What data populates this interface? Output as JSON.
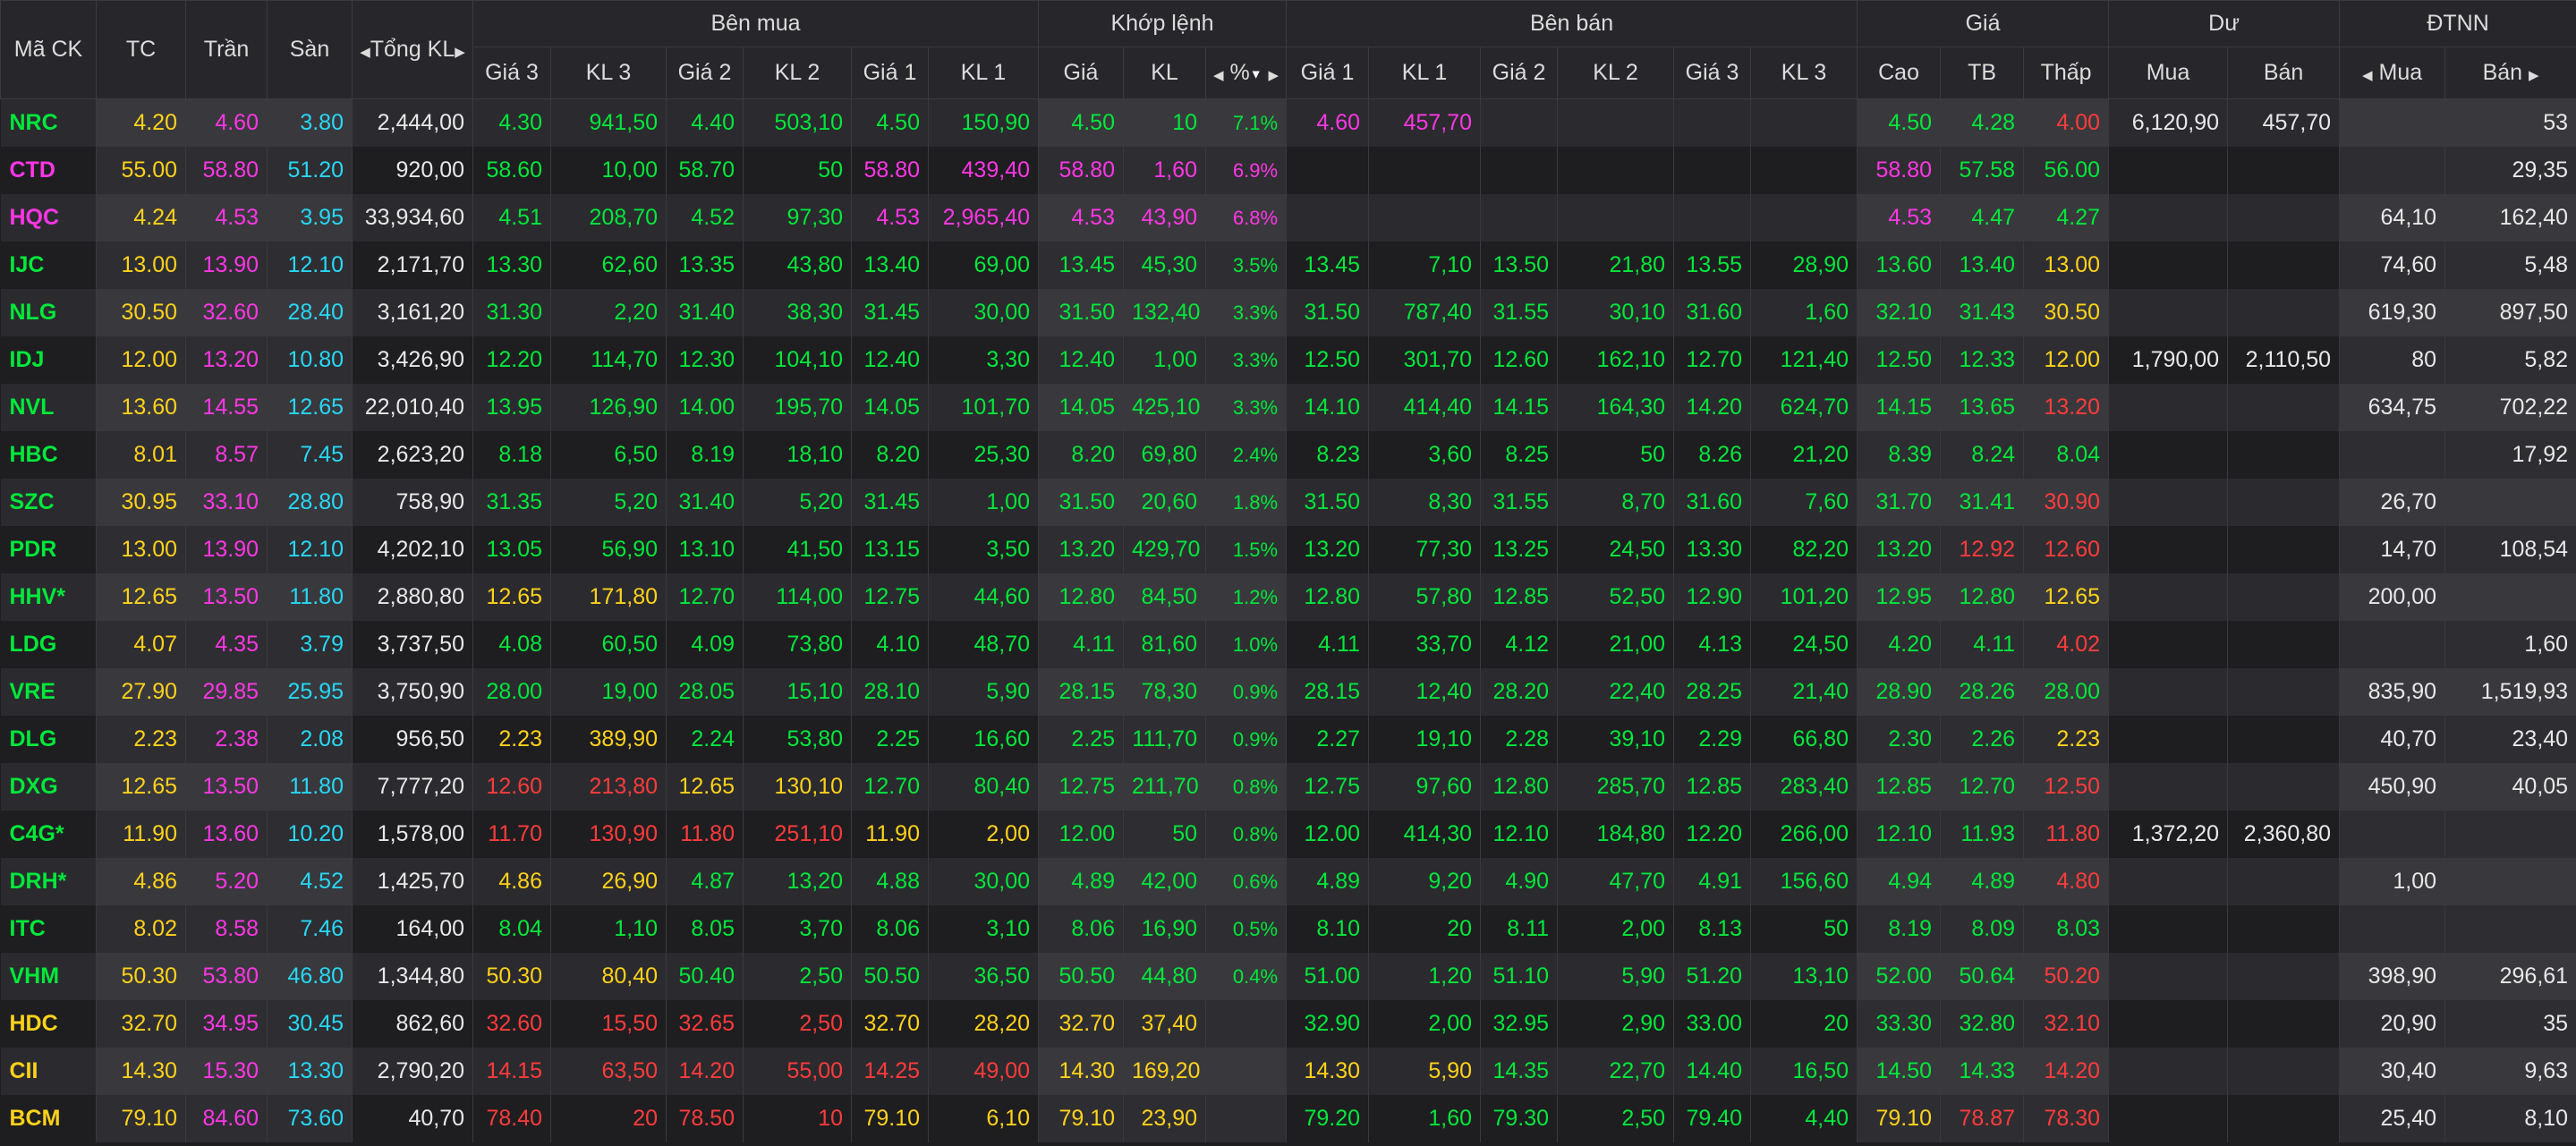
{
  "header": {
    "symbol": "Mã CK",
    "ref": "TC",
    "ceiling": "Trần",
    "floor": "Sàn",
    "total_vol": "Tổng KL",
    "buy_group": "Bên mua",
    "match_group": "Khớp lệnh",
    "sell_group": "Bên bán",
    "price_group": "Giá",
    "remain_group": "Dư",
    "foreign_group": "ĐTNN",
    "sub": {
      "price3": "Giá 3",
      "vol3": "KL 3",
      "price2": "Giá 2",
      "vol2": "KL 2",
      "price1": "Giá 1",
      "vol1": "KL 1",
      "match_price": "Giá",
      "match_vol": "KL",
      "match_pct": "%",
      "high": "Cao",
      "avg": "TB",
      "low": "Thấp",
      "remain_buy": "Mua",
      "remain_sell": "Bán",
      "foreign_buy": "Mua",
      "foreign_sell": "Bán"
    }
  },
  "colors": {
    "up": "#00e83a",
    "ref": "#ffd21a",
    "down": "#ff3b3b",
    "ceiling": "#ff36e5",
    "floor": "#27d8f5",
    "neutral": "#e8e8e8",
    "header_bg": "#27272b",
    "row_odd": "#2b2b2f",
    "row_even": "#1e1e21"
  },
  "icons": {
    "arrow_left": "caret-left-icon",
    "arrow_right": "caret-right-icon",
    "sort_desc": "sort-desc-icon"
  },
  "rows": [
    {
      "sym": "NRC",
      "tc": "4.20",
      "tran": "4.60",
      "san": "3.80",
      "tkl": "2,444,00",
      "g3": "4.30",
      "k3": "941,50",
      "g2": "4.40",
      "k2": "503,10",
      "g1": "4.50",
      "k1": "150,90",
      "mp": "4.50",
      "mv": "10",
      "pct": "7.1%",
      "s1": "4.60",
      "sk1": "457,70",
      "s2": "",
      "sk2": "",
      "s3": "",
      "sk3": "",
      "hi": "4.50",
      "avg": "4.28",
      "lo": "4.00",
      "rb": "6,120,90",
      "rs": "457,70",
      "fb": "",
      "fs": "53",
      "c": {
        "sym": "g",
        "b3": "g",
        "b2": "g",
        "b1": "g",
        "m": "g",
        "s1": "m",
        "s2": "g",
        "s3": "g",
        "hi": "g",
        "avg": "g",
        "lo": "r"
      }
    },
    {
      "sym": "CTD",
      "tc": "55.00",
      "tran": "58.80",
      "san": "51.20",
      "tkl": "920,00",
      "g3": "58.60",
      "k3": "10,00",
      "g2": "58.70",
      "k2": "50",
      "g1": "58.80",
      "k1": "439,40",
      "mp": "58.80",
      "mv": "1,60",
      "pct": "6.9%",
      "s1": "",
      "sk1": "",
      "s2": "",
      "sk2": "",
      "s3": "",
      "sk3": "",
      "hi": "58.80",
      "avg": "57.58",
      "lo": "56.00",
      "rb": "",
      "rs": "",
      "fb": "",
      "fs": "29,35",
      "c": {
        "sym": "m",
        "b3": "g",
        "b2": "g",
        "b1": "m",
        "m": "m",
        "s1": "g",
        "s2": "g",
        "s3": "g",
        "hi": "m",
        "avg": "g",
        "lo": "g"
      }
    },
    {
      "sym": "HQC",
      "tc": "4.24",
      "tran": "4.53",
      "san": "3.95",
      "tkl": "33,934,60",
      "g3": "4.51",
      "k3": "208,70",
      "g2": "4.52",
      "k2": "97,30",
      "g1": "4.53",
      "k1": "2,965,40",
      "mp": "4.53",
      "mv": "43,90",
      "pct": "6.8%",
      "s1": "",
      "sk1": "",
      "s2": "",
      "sk2": "",
      "s3": "",
      "sk3": "",
      "hi": "4.53",
      "avg": "4.47",
      "lo": "4.27",
      "rb": "",
      "rs": "",
      "fb": "64,10",
      "fs": "162,40",
      "c": {
        "sym": "m",
        "b3": "g",
        "b2": "g",
        "b1": "m",
        "m": "m",
        "s1": "g",
        "s2": "g",
        "s3": "g",
        "hi": "m",
        "avg": "g",
        "lo": "g"
      }
    },
    {
      "sym": "IJC",
      "tc": "13.00",
      "tran": "13.90",
      "san": "12.10",
      "tkl": "2,171,70",
      "g3": "13.30",
      "k3": "62,60",
      "g2": "13.35",
      "k2": "43,80",
      "g1": "13.40",
      "k1": "69,00",
      "mp": "13.45",
      "mv": "45,30",
      "pct": "3.5%",
      "s1": "13.45",
      "sk1": "7,10",
      "s2": "13.50",
      "sk2": "21,80",
      "s3": "13.55",
      "sk3": "28,90",
      "hi": "13.60",
      "avg": "13.40",
      "lo": "13.00",
      "rb": "",
      "rs": "",
      "fb": "74,60",
      "fs": "5,48",
      "c": {
        "sym": "g",
        "b3": "g",
        "b2": "g",
        "b1": "g",
        "m": "g",
        "s1": "g",
        "s2": "g",
        "s3": "g",
        "hi": "g",
        "avg": "g",
        "lo": "y"
      }
    },
    {
      "sym": "NLG",
      "tc": "30.50",
      "tran": "32.60",
      "san": "28.40",
      "tkl": "3,161,20",
      "g3": "31.30",
      "k3": "2,20",
      "g2": "31.40",
      "k2": "38,30",
      "g1": "31.45",
      "k1": "30,00",
      "mp": "31.50",
      "mv": "132,40",
      "pct": "3.3%",
      "s1": "31.50",
      "sk1": "787,40",
      "s2": "31.55",
      "sk2": "30,10",
      "s3": "31.60",
      "sk3": "1,60",
      "hi": "32.10",
      "avg": "31.43",
      "lo": "30.50",
      "rb": "",
      "rs": "",
      "fb": "619,30",
      "fs": "897,50",
      "c": {
        "sym": "g",
        "b3": "g",
        "b2": "g",
        "b1": "g",
        "m": "g",
        "s1": "g",
        "s2": "g",
        "s3": "g",
        "hi": "g",
        "avg": "g",
        "lo": "y"
      }
    },
    {
      "sym": "IDJ",
      "tc": "12.00",
      "tran": "13.20",
      "san": "10.80",
      "tkl": "3,426,90",
      "g3": "12.20",
      "k3": "114,70",
      "g2": "12.30",
      "k2": "104,10",
      "g1": "12.40",
      "k1": "3,30",
      "mp": "12.40",
      "mv": "1,00",
      "pct": "3.3%",
      "s1": "12.50",
      "sk1": "301,70",
      "s2": "12.60",
      "sk2": "162,10",
      "s3": "12.70",
      "sk3": "121,40",
      "hi": "12.50",
      "avg": "12.33",
      "lo": "12.00",
      "rb": "1,790,00",
      "rs": "2,110,50",
      "fb": "80",
      "fs": "5,82",
      "c": {
        "sym": "g",
        "b3": "g",
        "b2": "g",
        "b1": "g",
        "m": "g",
        "s1": "g",
        "s2": "g",
        "s3": "g",
        "hi": "g",
        "avg": "g",
        "lo": "y"
      }
    },
    {
      "sym": "NVL",
      "tc": "13.60",
      "tran": "14.55",
      "san": "12.65",
      "tkl": "22,010,40",
      "g3": "13.95",
      "k3": "126,90",
      "g2": "14.00",
      "k2": "195,70",
      "g1": "14.05",
      "k1": "101,70",
      "mp": "14.05",
      "mv": "425,10",
      "pct": "3.3%",
      "s1": "14.10",
      "sk1": "414,40",
      "s2": "14.15",
      "sk2": "164,30",
      "s3": "14.20",
      "sk3": "624,70",
      "hi": "14.15",
      "avg": "13.65",
      "lo": "13.20",
      "rb": "",
      "rs": "",
      "fb": "634,75",
      "fs": "702,22",
      "c": {
        "sym": "g",
        "b3": "g",
        "b2": "g",
        "b1": "g",
        "m": "g",
        "s1": "g",
        "s2": "g",
        "s3": "g",
        "hi": "g",
        "avg": "g",
        "lo": "r"
      }
    },
    {
      "sym": "HBC",
      "tc": "8.01",
      "tran": "8.57",
      "san": "7.45",
      "tkl": "2,623,20",
      "g3": "8.18",
      "k3": "6,50",
      "g2": "8.19",
      "k2": "18,10",
      "g1": "8.20",
      "k1": "25,30",
      "mp": "8.20",
      "mv": "69,80",
      "pct": "2.4%",
      "s1": "8.23",
      "sk1": "3,60",
      "s2": "8.25",
      "sk2": "50",
      "s3": "8.26",
      "sk3": "21,20",
      "hi": "8.39",
      "avg": "8.24",
      "lo": "8.04",
      "rb": "",
      "rs": "",
      "fb": "",
      "fs": "17,92",
      "c": {
        "sym": "g",
        "b3": "g",
        "b2": "g",
        "b1": "g",
        "m": "g",
        "s1": "g",
        "s2": "g",
        "s3": "g",
        "hi": "g",
        "avg": "g",
        "lo": "g"
      }
    },
    {
      "sym": "SZC",
      "tc": "30.95",
      "tran": "33.10",
      "san": "28.80",
      "tkl": "758,90",
      "g3": "31.35",
      "k3": "5,20",
      "g2": "31.40",
      "k2": "5,20",
      "g1": "31.45",
      "k1": "1,00",
      "mp": "31.50",
      "mv": "20,60",
      "pct": "1.8%",
      "s1": "31.50",
      "sk1": "8,30",
      "s2": "31.55",
      "sk2": "8,70",
      "s3": "31.60",
      "sk3": "7,60",
      "hi": "31.70",
      "avg": "31.41",
      "lo": "30.90",
      "rb": "",
      "rs": "",
      "fb": "26,70",
      "fs": "",
      "c": {
        "sym": "g",
        "b3": "g",
        "b2": "g",
        "b1": "g",
        "m": "g",
        "s1": "g",
        "s2": "g",
        "s3": "g",
        "hi": "g",
        "avg": "g",
        "lo": "r"
      }
    },
    {
      "sym": "PDR",
      "tc": "13.00",
      "tran": "13.90",
      "san": "12.10",
      "tkl": "4,202,10",
      "g3": "13.05",
      "k3": "56,90",
      "g2": "13.10",
      "k2": "41,50",
      "g1": "13.15",
      "k1": "3,50",
      "mp": "13.20",
      "mv": "429,70",
      "pct": "1.5%",
      "s1": "13.20",
      "sk1": "77,30",
      "s2": "13.25",
      "sk2": "24,50",
      "s3": "13.30",
      "sk3": "82,20",
      "hi": "13.20",
      "avg": "12.92",
      "lo": "12.60",
      "rb": "",
      "rs": "",
      "fb": "14,70",
      "fs": "108,54",
      "c": {
        "sym": "g",
        "b3": "g",
        "b2": "g",
        "b1": "g",
        "m": "g",
        "s1": "g",
        "s2": "g",
        "s3": "g",
        "hi": "g",
        "avg": "r",
        "lo": "r"
      }
    },
    {
      "sym": "HHV*",
      "tc": "12.65",
      "tran": "13.50",
      "san": "11.80",
      "tkl": "2,880,80",
      "g3": "12.65",
      "k3": "171,80",
      "g2": "12.70",
      "k2": "114,00",
      "g1": "12.75",
      "k1": "44,60",
      "mp": "12.80",
      "mv": "84,50",
      "pct": "1.2%",
      "s1": "12.80",
      "sk1": "57,80",
      "s2": "12.85",
      "sk2": "52,50",
      "s3": "12.90",
      "sk3": "101,20",
      "hi": "12.95",
      "avg": "12.80",
      "lo": "12.65",
      "rb": "",
      "rs": "",
      "fb": "200,00",
      "fs": "",
      "c": {
        "sym": "g",
        "b3": "y",
        "b2": "g",
        "b1": "g",
        "m": "g",
        "s1": "g",
        "s2": "g",
        "s3": "g",
        "hi": "g",
        "avg": "g",
        "lo": "y"
      }
    },
    {
      "sym": "LDG",
      "tc": "4.07",
      "tran": "4.35",
      "san": "3.79",
      "tkl": "3,737,50",
      "g3": "4.08",
      "k3": "60,50",
      "g2": "4.09",
      "k2": "73,80",
      "g1": "4.10",
      "k1": "48,70",
      "mp": "4.11",
      "mv": "81,60",
      "pct": "1.0%",
      "s1": "4.11",
      "sk1": "33,70",
      "s2": "4.12",
      "sk2": "21,00",
      "s3": "4.13",
      "sk3": "24,50",
      "hi": "4.20",
      "avg": "4.11",
      "lo": "4.02",
      "rb": "",
      "rs": "",
      "fb": "",
      "fs": "1,60",
      "c": {
        "sym": "g",
        "b3": "g",
        "b2": "g",
        "b1": "g",
        "m": "g",
        "s1": "g",
        "s2": "g",
        "s3": "g",
        "hi": "g",
        "avg": "g",
        "lo": "r"
      }
    },
    {
      "sym": "VRE",
      "tc": "27.90",
      "tran": "29.85",
      "san": "25.95",
      "tkl": "3,750,90",
      "g3": "28.00",
      "k3": "19,00",
      "g2": "28.05",
      "k2": "15,10",
      "g1": "28.10",
      "k1": "5,90",
      "mp": "28.15",
      "mv": "78,30",
      "pct": "0.9%",
      "s1": "28.15",
      "sk1": "12,40",
      "s2": "28.20",
      "sk2": "22,40",
      "s3": "28.25",
      "sk3": "21,40",
      "hi": "28.90",
      "avg": "28.26",
      "lo": "28.00",
      "rb": "",
      "rs": "",
      "fb": "835,90",
      "fs": "1,519,93",
      "c": {
        "sym": "g",
        "b3": "g",
        "b2": "g",
        "b1": "g",
        "m": "g",
        "s1": "g",
        "s2": "g",
        "s3": "g",
        "hi": "g",
        "avg": "g",
        "lo": "g"
      }
    },
    {
      "sym": "DLG",
      "tc": "2.23",
      "tran": "2.38",
      "san": "2.08",
      "tkl": "956,50",
      "g3": "2.23",
      "k3": "389,90",
      "g2": "2.24",
      "k2": "53,80",
      "g1": "2.25",
      "k1": "16,60",
      "mp": "2.25",
      "mv": "111,70",
      "pct": "0.9%",
      "s1": "2.27",
      "sk1": "19,10",
      "s2": "2.28",
      "sk2": "39,10",
      "s3": "2.29",
      "sk3": "66,80",
      "hi": "2.30",
      "avg": "2.26",
      "lo": "2.23",
      "rb": "",
      "rs": "",
      "fb": "40,70",
      "fs": "23,40",
      "c": {
        "sym": "g",
        "b3": "y",
        "b2": "g",
        "b1": "g",
        "m": "g",
        "s1": "g",
        "s2": "g",
        "s3": "g",
        "hi": "g",
        "avg": "g",
        "lo": "y"
      }
    },
    {
      "sym": "DXG",
      "tc": "12.65",
      "tran": "13.50",
      "san": "11.80",
      "tkl": "7,777,20",
      "g3": "12.60",
      "k3": "213,80",
      "g2": "12.65",
      "k2": "130,10",
      "g1": "12.70",
      "k1": "80,40",
      "mp": "12.75",
      "mv": "211,70",
      "pct": "0.8%",
      "s1": "12.75",
      "sk1": "97,60",
      "s2": "12.80",
      "sk2": "285,70",
      "s3": "12.85",
      "sk3": "283,40",
      "hi": "12.85",
      "avg": "12.70",
      "lo": "12.50",
      "rb": "",
      "rs": "",
      "fb": "450,90",
      "fs": "40,05",
      "c": {
        "sym": "g",
        "b3": "r",
        "b2": "y",
        "b1": "g",
        "m": "g",
        "s1": "g",
        "s2": "g",
        "s3": "g",
        "hi": "g",
        "avg": "g",
        "lo": "r"
      }
    },
    {
      "sym": "C4G*",
      "tc": "11.90",
      "tran": "13.60",
      "san": "10.20",
      "tkl": "1,578,00",
      "g3": "11.70",
      "k3": "130,90",
      "g2": "11.80",
      "k2": "251,10",
      "g1": "11.90",
      "k1": "2,00",
      "mp": "12.00",
      "mv": "50",
      "pct": "0.8%",
      "s1": "12.00",
      "sk1": "414,30",
      "s2": "12.10",
      "sk2": "184,80",
      "s3": "12.20",
      "sk3": "266,00",
      "hi": "12.10",
      "avg": "11.93",
      "lo": "11.80",
      "rb": "1,372,20",
      "rs": "2,360,80",
      "fb": "",
      "fs": "",
      "c": {
        "sym": "g",
        "b3": "r",
        "b2": "r",
        "b1": "y",
        "m": "g",
        "s1": "g",
        "s2": "g",
        "s3": "g",
        "hi": "g",
        "avg": "g",
        "lo": "r"
      }
    },
    {
      "sym": "DRH*",
      "tc": "4.86",
      "tran": "5.20",
      "san": "4.52",
      "tkl": "1,425,70",
      "g3": "4.86",
      "k3": "26,90",
      "g2": "4.87",
      "k2": "13,20",
      "g1": "4.88",
      "k1": "30,00",
      "mp": "4.89",
      "mv": "42,00",
      "pct": "0.6%",
      "s1": "4.89",
      "sk1": "9,20",
      "s2": "4.90",
      "sk2": "47,70",
      "s3": "4.91",
      "sk3": "156,60",
      "hi": "4.94",
      "avg": "4.89",
      "lo": "4.80",
      "rb": "",
      "rs": "",
      "fb": "1,00",
      "fs": "",
      "c": {
        "sym": "g",
        "b3": "y",
        "b2": "g",
        "b1": "g",
        "m": "g",
        "s1": "g",
        "s2": "g",
        "s3": "g",
        "hi": "g",
        "avg": "g",
        "lo": "r"
      }
    },
    {
      "sym": "ITC",
      "tc": "8.02",
      "tran": "8.58",
      "san": "7.46",
      "tkl": "164,00",
      "g3": "8.04",
      "k3": "1,10",
      "g2": "8.05",
      "k2": "3,70",
      "g1": "8.06",
      "k1": "3,10",
      "mp": "8.06",
      "mv": "16,90",
      "pct": "0.5%",
      "s1": "8.10",
      "sk1": "20",
      "s2": "8.11",
      "sk2": "2,00",
      "s3": "8.13",
      "sk3": "50",
      "hi": "8.19",
      "avg": "8.09",
      "lo": "8.03",
      "rb": "",
      "rs": "",
      "fb": "",
      "fs": "",
      "c": {
        "sym": "g",
        "b3": "g",
        "b2": "g",
        "b1": "g",
        "m": "g",
        "s1": "g",
        "s2": "g",
        "s3": "g",
        "hi": "g",
        "avg": "g",
        "lo": "g"
      }
    },
    {
      "sym": "VHM",
      "tc": "50.30",
      "tran": "53.80",
      "san": "46.80",
      "tkl": "1,344,80",
      "g3": "50.30",
      "k3": "80,40",
      "g2": "50.40",
      "k2": "2,50",
      "g1": "50.50",
      "k1": "36,50",
      "mp": "50.50",
      "mv": "44,80",
      "pct": "0.4%",
      "s1": "51.00",
      "sk1": "1,20",
      "s2": "51.10",
      "sk2": "5,90",
      "s3": "51.20",
      "sk3": "13,10",
      "hi": "52.00",
      "avg": "50.64",
      "lo": "50.20",
      "rb": "",
      "rs": "",
      "fb": "398,90",
      "fs": "296,61",
      "c": {
        "sym": "g",
        "b3": "y",
        "b2": "g",
        "b1": "g",
        "m": "g",
        "s1": "g",
        "s2": "g",
        "s3": "g",
        "hi": "g",
        "avg": "g",
        "lo": "r"
      }
    },
    {
      "sym": "HDC",
      "tc": "32.70",
      "tran": "34.95",
      "san": "30.45",
      "tkl": "862,60",
      "g3": "32.60",
      "k3": "15,50",
      "g2": "32.65",
      "k2": "2,50",
      "g1": "32.70",
      "k1": "28,20",
      "mp": "32.70",
      "mv": "37,40",
      "pct": "",
      "s1": "32.90",
      "sk1": "2,00",
      "s2": "32.95",
      "sk2": "2,90",
      "s3": "33.00",
      "sk3": "20",
      "hi": "33.30",
      "avg": "32.80",
      "lo": "32.10",
      "rb": "",
      "rs": "",
      "fb": "20,90",
      "fs": "35",
      "c": {
        "sym": "y",
        "b3": "r",
        "b2": "r",
        "b1": "y",
        "m": "y",
        "s1": "g",
        "s2": "g",
        "s3": "g",
        "hi": "g",
        "avg": "g",
        "lo": "r"
      }
    },
    {
      "sym": "CII",
      "tc": "14.30",
      "tran": "15.30",
      "san": "13.30",
      "tkl": "2,790,20",
      "g3": "14.15",
      "k3": "63,50",
      "g2": "14.20",
      "k2": "55,00",
      "g1": "14.25",
      "k1": "49,00",
      "mp": "14.30",
      "mv": "169,20",
      "pct": "",
      "s1": "14.30",
      "sk1": "5,90",
      "s2": "14.35",
      "sk2": "22,70",
      "s3": "14.40",
      "sk3": "16,50",
      "hi": "14.50",
      "avg": "14.33",
      "lo": "14.20",
      "rb": "",
      "rs": "",
      "fb": "30,40",
      "fs": "9,63",
      "c": {
        "sym": "y",
        "b3": "r",
        "b2": "r",
        "b1": "r",
        "m": "y",
        "s1": "y",
        "s2": "g",
        "s3": "g",
        "hi": "g",
        "avg": "g",
        "lo": "r"
      }
    },
    {
      "sym": "BCM",
      "tc": "79.10",
      "tran": "84.60",
      "san": "73.60",
      "tkl": "40,70",
      "g3": "78.40",
      "k3": "20",
      "g2": "78.50",
      "k2": "10",
      "g1": "79.10",
      "k1": "6,10",
      "mp": "79.10",
      "mv": "23,90",
      "pct": "",
      "s1": "79.20",
      "sk1": "1,60",
      "s2": "79.30",
      "sk2": "2,50",
      "s3": "79.40",
      "sk3": "4,40",
      "hi": "79.10",
      "avg": "78.87",
      "lo": "78.30",
      "rb": "",
      "rs": "",
      "fb": "25,40",
      "fs": "8,10",
      "c": {
        "sym": "y",
        "b3": "r",
        "b2": "r",
        "b1": "y",
        "m": "y",
        "s1": "g",
        "s2": "g",
        "s3": "g",
        "hi": "y",
        "avg": "r",
        "lo": "r"
      }
    }
  ]
}
